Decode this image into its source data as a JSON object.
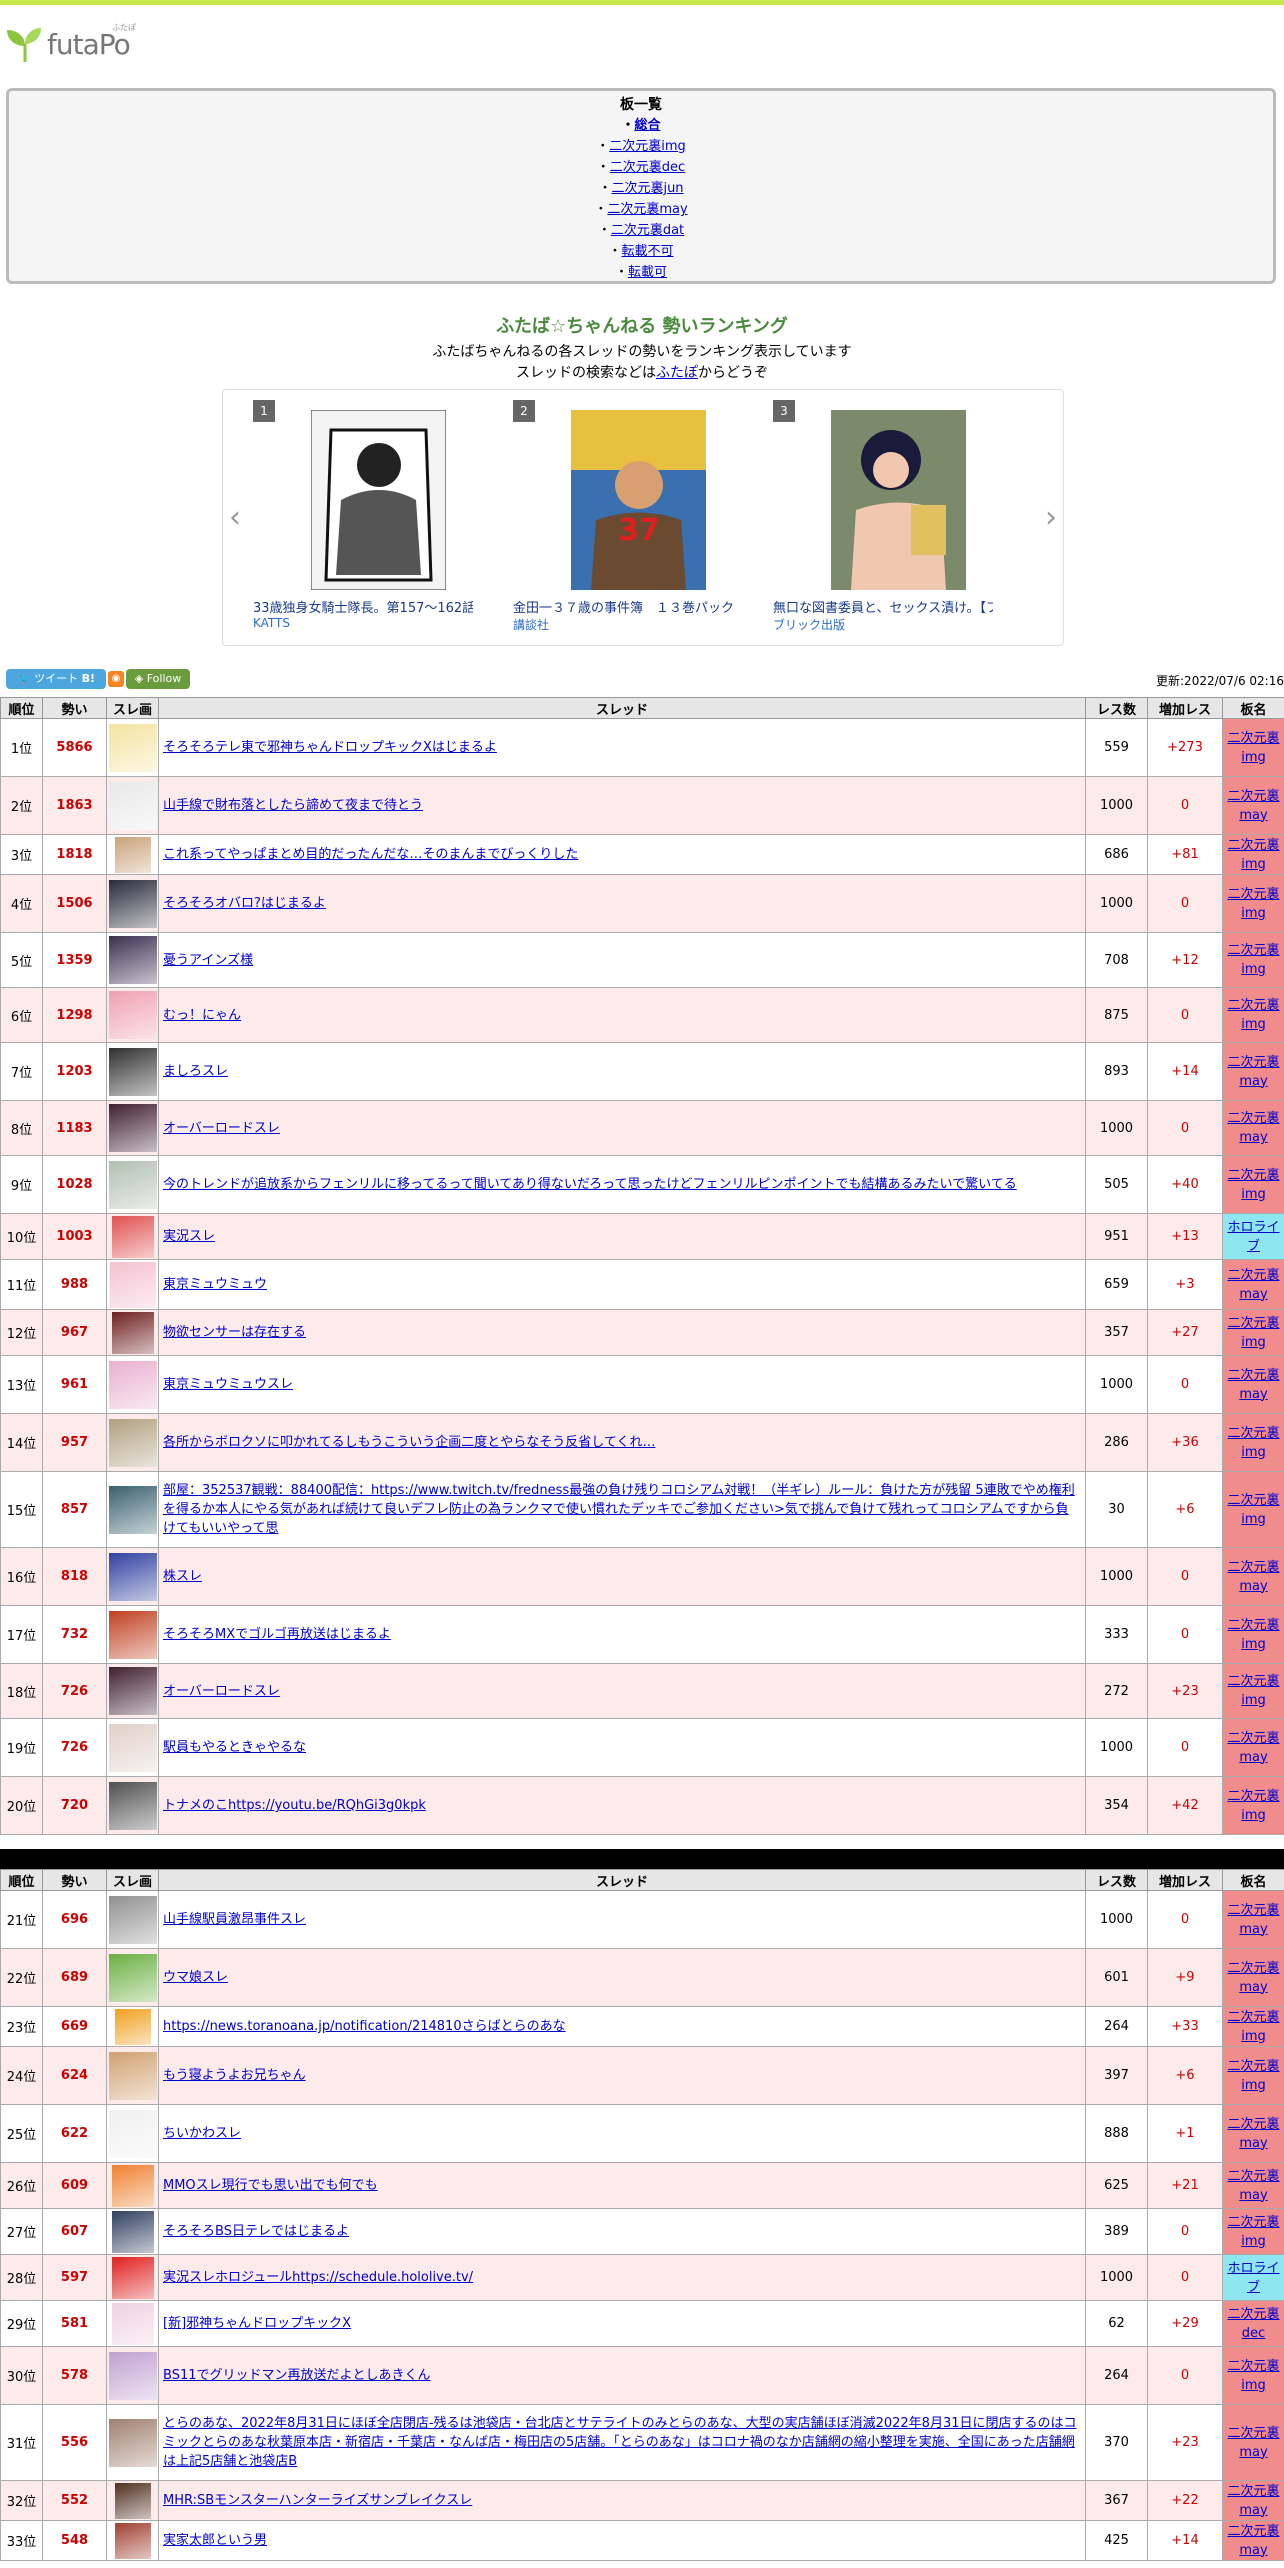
{
  "logo": {
    "text": "futaPo",
    "sub": "ふたぽ"
  },
  "boards": {
    "title": "板一覧",
    "items": [
      "総合",
      "二次元裏img",
      "二次元裏dec",
      "二次元裏jun",
      "二次元裏may",
      "二次元裏dat",
      "転載不可",
      "転載可"
    ]
  },
  "ranking": {
    "title": "ふたば☆ちゃんねる 勢いランキング",
    "desc1": "ふたばちゃんねるの各スレッドの勢いをランキング表示しています",
    "desc2_pre": "スレッドの検索などは",
    "desc2_link": "ふたぽ",
    "desc2_post": "からどうぞ"
  },
  "carousel": {
    "prev": "‹",
    "next": "›",
    "items": [
      {
        "num": "1",
        "title": "33歳独身女騎士隊長。第157～162話",
        "publisher": "KATTS",
        "cover_color": "#e8e8e8"
      },
      {
        "num": "2",
        "title": "金田一３７歳の事件簿　１３巻パック",
        "publisher": "講談社",
        "cover_color": "#3a6fb0"
      },
      {
        "num": "3",
        "title": "無口な図書委員と、セックス漬け。【フル",
        "publisher": "ブリック出版",
        "cover_color": "#6a5a8a"
      }
    ]
  },
  "social": {
    "tweet": "ツイート",
    "b": "B!",
    "follow": "Follow",
    "rss": "RSS"
  },
  "updated": "更新:2022/07/6 02:16",
  "table": {
    "headers": [
      "順位",
      "勢い",
      "スレ画",
      "スレッド",
      "レス数",
      "増加レス",
      "板名"
    ]
  },
  "rows1": [
    {
      "rank": "1位",
      "ikioi": "5866",
      "thread": "そろそろテレ東で邪神ちゃんドロップキックXはじまるよ",
      "res": "559",
      "add": "+273",
      "board": "二次元裏img",
      "thumb": "#f4e3a0",
      "h": 58
    },
    {
      "rank": "2位",
      "ikioi": "1863",
      "thread": "山手線で財布落としたら諦めて夜まで待とう",
      "res": "1000",
      "add": "0",
      "board": "二次元裏may",
      "thumb": "#e8e8e8",
      "h": 58
    },
    {
      "rank": "3位",
      "ikioi": "1818",
      "thread": "これ系ってやっぱまとめ目的だったんだな…そのまんまでびっくりした",
      "res": "686",
      "add": "+81",
      "board": "二次元裏img",
      "thumb": "#c9a27a",
      "h": 40
    },
    {
      "rank": "4位",
      "ikioi": "1506",
      "thread": "そろそろオバロ?はじまるよ",
      "res": "1000",
      "add": "0",
      "board": "二次元裏img",
      "thumb": "#2a2a3a",
      "h": 58
    },
    {
      "rank": "5位",
      "ikioi": "1359",
      "thread": "憂うアインズ様",
      "res": "708",
      "add": "+12",
      "board": "二次元裏img",
      "thumb": "#3a3050",
      "h": 55
    },
    {
      "rank": "6位",
      "ikioi": "1298",
      "thread": "むっ！にゃん",
      "res": "875",
      "add": "0",
      "board": "二次元裏img",
      "thumb": "#f0a0b0",
      "h": 55
    },
    {
      "rank": "7位",
      "ikioi": "1203",
      "thread": "ましろスレ",
      "res": "893",
      "add": "+14",
      "board": "二次元裏may",
      "thumb": "#303030",
      "h": 58
    },
    {
      "rank": "8位",
      "ikioi": "1183",
      "thread": "オーバーロードスレ",
      "res": "1000",
      "add": "0",
      "board": "二次元裏may",
      "thumb": "#402030",
      "h": 55
    },
    {
      "rank": "9位",
      "ikioi": "1028",
      "thread": "今のトレンドが追放系からフェンリルに移ってるって聞いてあり得ないだろって思ったけどフェンリルピンポイントでも結構あるみたいで驚いてる",
      "res": "505",
      "add": "+40",
      "board": "二次元裏img",
      "thumb": "#b0c0b0",
      "h": 58
    },
    {
      "rank": "10位",
      "ikioi": "1003",
      "thread": "実況スレ",
      "res": "951",
      "add": "+13",
      "board": "ホロライブ",
      "thumb": "#e05050",
      "h": 46,
      "holo": true
    },
    {
      "rank": "11位",
      "ikioi": "988",
      "thread": "東京ミュウミュウ",
      "res": "659",
      "add": "+3",
      "board": "二次元裏may",
      "thumb": "#f4c0d0",
      "h": 50
    },
    {
      "rank": "12位",
      "ikioi": "967",
      "thread": "物欲センサーは存在する",
      "res": "357",
      "add": "+27",
      "board": "二次元裏img",
      "thumb": "#702020",
      "h": 46
    },
    {
      "rank": "13位",
      "ikioi": "961",
      "thread": "東京ミュウミュウスレ",
      "res": "1000",
      "add": "0",
      "board": "二次元裏may",
      "thumb": "#e8b0d0",
      "h": 58
    },
    {
      "rank": "14位",
      "ikioi": "957",
      "thread": "各所からボロクソに叩かれてるしもうこういう企画二度とやらなそう反省してくれ…",
      "res": "286",
      "add": "+36",
      "board": "二次元裏img",
      "thumb": "#b0a080",
      "h": 58
    },
    {
      "rank": "15位",
      "ikioi": "857",
      "thread": "部屋：352537観戦：88400配信：https://www.twitch.tv/fredness最強の負け残りコロシアム対戦！（半ギレ）ルール：負けた方が残留 5連敗でやめ権利を得るか本人にやる気があれば続けて良いデフレ防止の為ランクマで使い慣れたデッキでご参加ください>気で挑んで負けて残れってコロシアムですから負けてもいいやって思",
      "res": "30",
      "add": "+6",
      "board": "二次元裏img",
      "thumb": "#3a6070",
      "h": 76
    },
    {
      "rank": "16位",
      "ikioi": "818",
      "thread": "株スレ",
      "res": "1000",
      "add": "0",
      "board": "二次元裏may",
      "thumb": "#3040a0",
      "h": 58
    },
    {
      "rank": "17位",
      "ikioi": "732",
      "thread": "そろそろMXでゴルゴ再放送はじまるよ",
      "res": "333",
      "add": "0",
      "board": "二次元裏img",
      "thumb": "#c04020",
      "h": 58
    },
    {
      "rank": "18位",
      "ikioi": "726",
      "thread": "オーバーロードスレ",
      "res": "272",
      "add": "+23",
      "board": "二次元裏img",
      "thumb": "#402030",
      "h": 55
    },
    {
      "rank": "19位",
      "ikioi": "726",
      "thread": "駅員もやるときゃやるな",
      "res": "1000",
      "add": "0",
      "board": "二次元裏may",
      "thumb": "#e0d0c8",
      "h": 58
    },
    {
      "rank": "20位",
      "ikioi": "720",
      "thread": "トナメのこhttps://youtu.be/RQhGi3g0kpk",
      "res": "354",
      "add": "+42",
      "board": "二次元裏img",
      "thumb": "#505050",
      "h": 58
    }
  ],
  "rows2": [
    {
      "rank": "21位",
      "ikioi": "696",
      "thread": "山手線駅員激昂事件スレ",
      "res": "1000",
      "add": "0",
      "board": "二次元裏may",
      "thumb": "#909090",
      "h": 58
    },
    {
      "rank": "22位",
      "ikioi": "689",
      "thread": "ウマ娘スレ",
      "res": "601",
      "add": "+9",
      "board": "二次元裏may",
      "thumb": "#6ab040",
      "h": 58
    },
    {
      "rank": "23位",
      "ikioi": "669",
      "thread": "https://news.toranoana.jp/notification/214810さらばとらのあな",
      "res": "264",
      "add": "+33",
      "board": "二次元裏img",
      "thumb": "#f0a020",
      "h": 40
    },
    {
      "rank": "24位",
      "ikioi": "624",
      "thread": "もう寝ようよお兄ちゃん",
      "res": "397",
      "add": "+6",
      "board": "二次元裏img",
      "thumb": "#d0a070",
      "h": 58
    },
    {
      "rank": "25位",
      "ikioi": "622",
      "thread": "ちいかわスレ",
      "res": "888",
      "add": "+1",
      "board": "二次元裏may",
      "thumb": "#f0f0f0",
      "h": 58
    },
    {
      "rank": "26位",
      "ikioi": "609",
      "thread": "MMOスレ現行でも思い出でも何でも",
      "res": "625",
      "add": "+21",
      "board": "二次元裏may",
      "thumb": "#f08030",
      "h": 46
    },
    {
      "rank": "27位",
      "ikioi": "607",
      "thread": "そろそろBS日テレではじまるよ",
      "res": "389",
      "add": "0",
      "board": "二次元裏img",
      "thumb": "#304060",
      "h": 46
    },
    {
      "rank": "28位",
      "ikioi": "597",
      "thread": "実況スレホロジュールhttps://schedule.hololive.tv/",
      "res": "1000",
      "add": "0",
      "board": "ホロライブ",
      "thumb": "#e02020",
      "h": 46,
      "holo": true
    },
    {
      "rank": "29位",
      "ikioi": "581",
      "thread": "[新]邪神ちゃんドロップキックX",
      "res": "62",
      "add": "+29",
      "board": "二次元裏dec",
      "thumb": "#f0d0e0",
      "h": 46
    },
    {
      "rank": "30位",
      "ikioi": "578",
      "thread": "BS11でグリッドマン再放送だよとしあきくん",
      "res": "264",
      "add": "0",
      "board": "二次元裏img",
      "thumb": "#c0a0d0",
      "h": 58
    },
    {
      "rank": "31位",
      "ikioi": "556",
      "thread": "とらのあな、2022年8月31日にほぼ全店閉店‐残るは池袋店・台北店とサテライトのみとらのあな、大型の実店舗ほぼ消滅2022年8月31日に閉店するのはコミックとらのあな秋葉原本店・新宿店・千葉店・なんば店・梅田店の5店舗。「とらのあな」はコロナ禍のなか店舗網の縮小整理を実施、全国にあった店舗網は上記5店舗と池袋店B",
      "res": "370",
      "add": "+23",
      "board": "二次元裏may",
      "thumb": "#a08070",
      "h": 76
    },
    {
      "rank": "32位",
      "ikioi": "552",
      "thread": "MHR:SBモンスターハンターライズサンブレイクスレ",
      "res": "367",
      "add": "+22",
      "board": "二次元裏may",
      "thumb": "#503020",
      "h": 40
    },
    {
      "rank": "33位",
      "ikioi": "548",
      "thread": "実家太郎という男",
      "res": "425",
      "add": "+14",
      "board": "二次元裏may",
      "thumb": "#a04030",
      "h": 40
    }
  ]
}
